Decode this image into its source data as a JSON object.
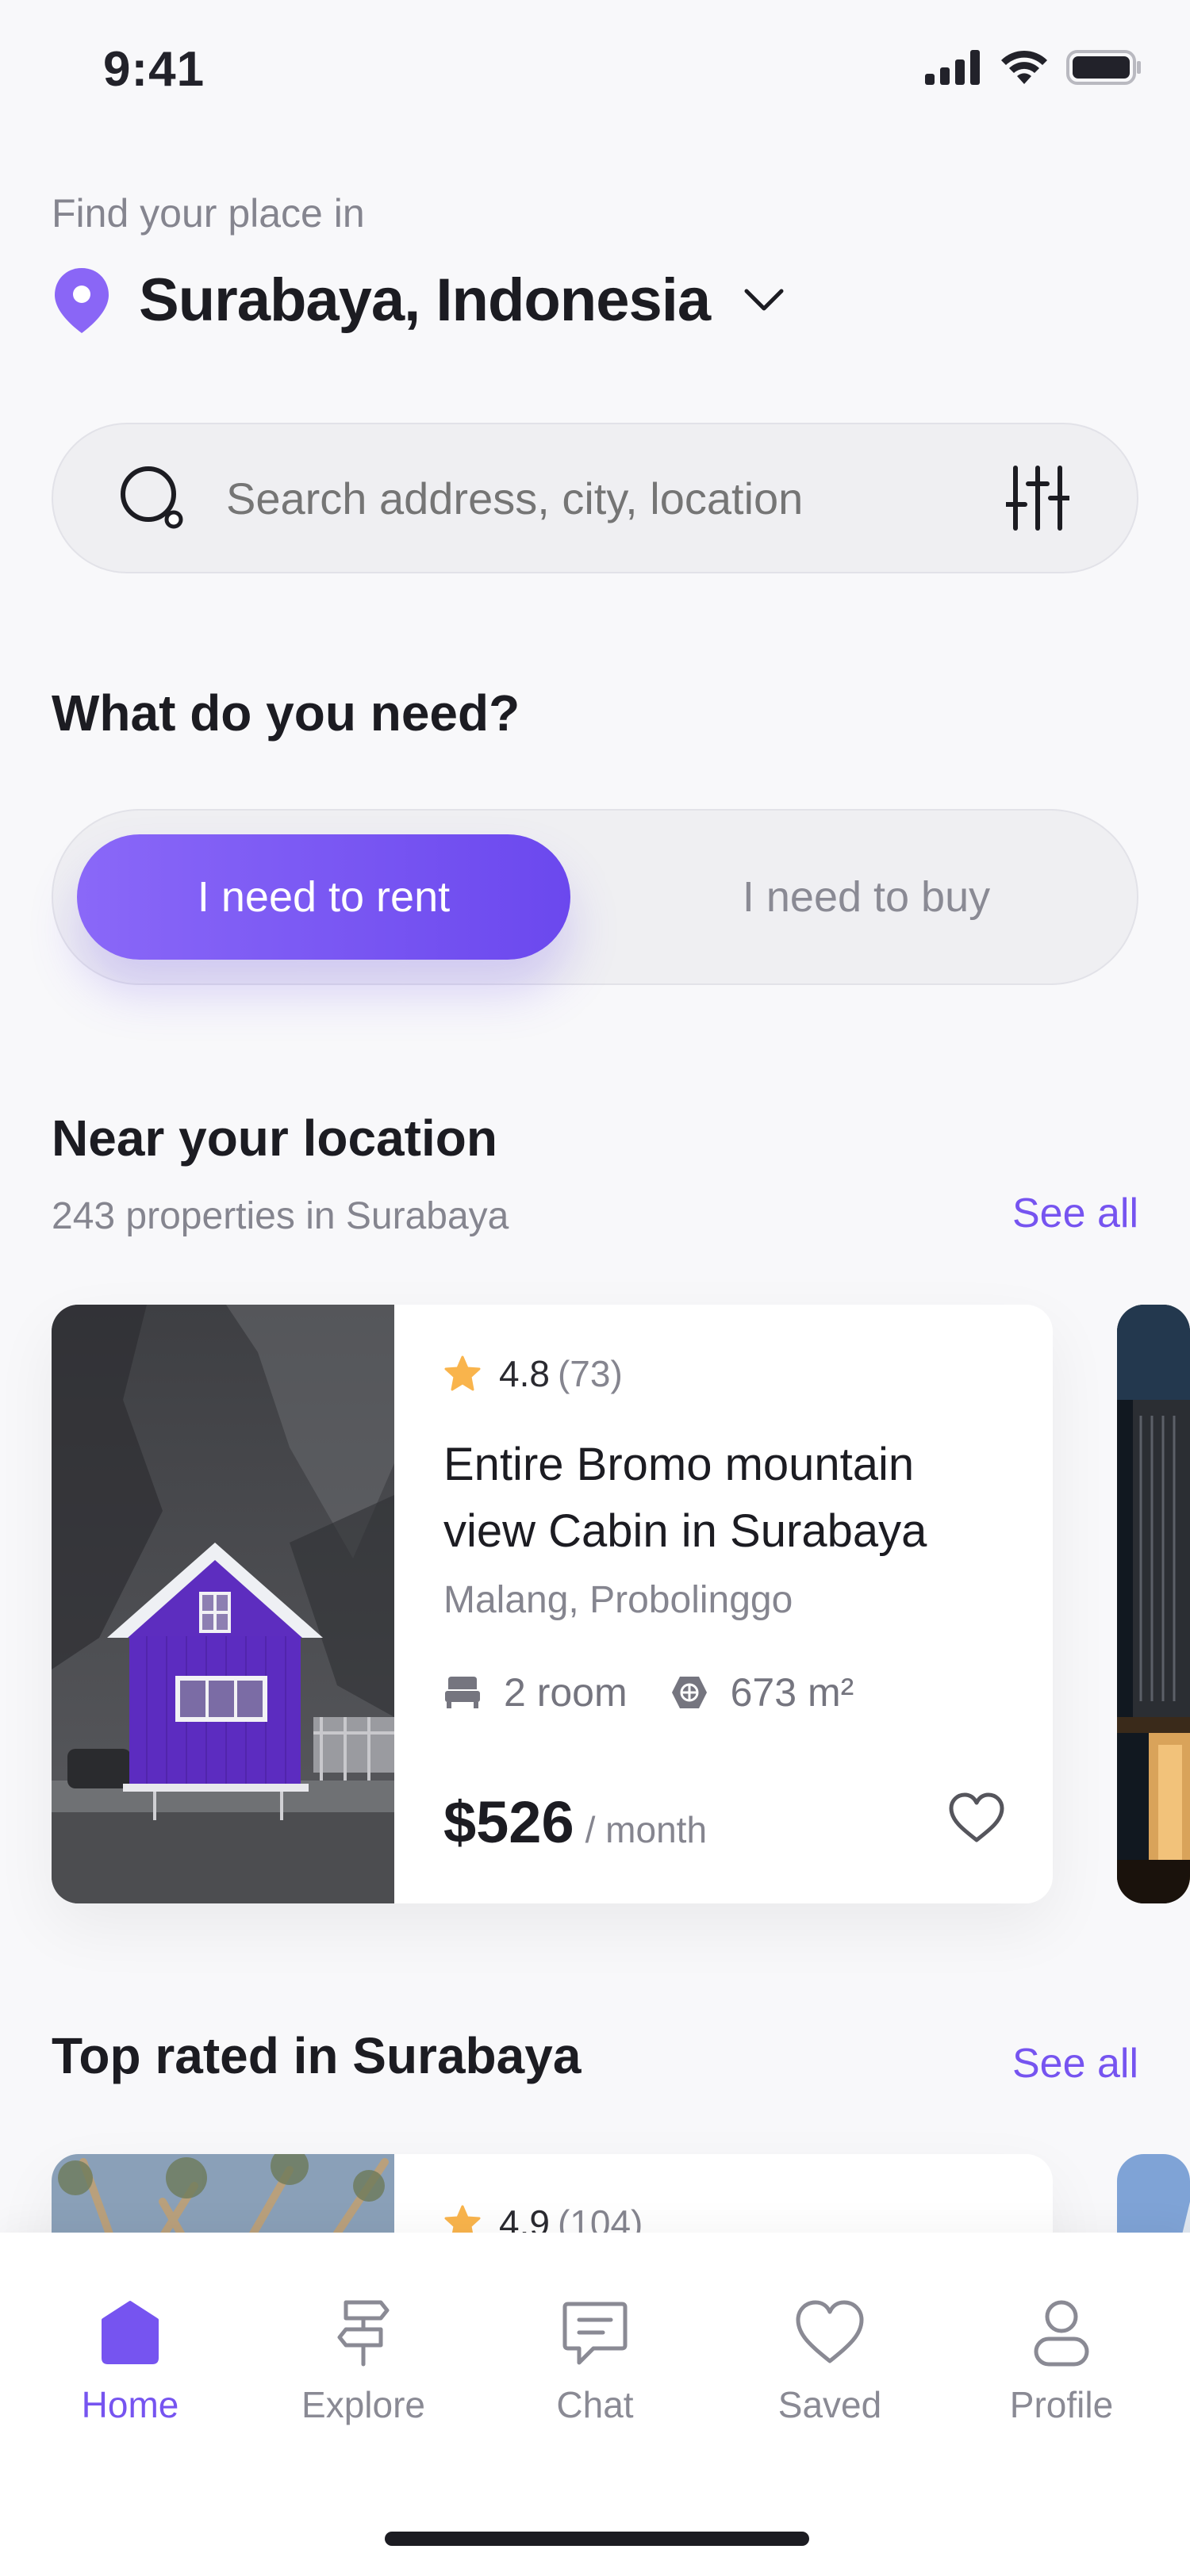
{
  "status_bar": {
    "time": "9:41"
  },
  "header": {
    "find_label": "Find your place in",
    "location": "Surabaya, Indonesia"
  },
  "search": {
    "placeholder": "Search address, city, location"
  },
  "need": {
    "title": "What do you need?",
    "options": [
      {
        "label": "I need to rent",
        "selected": true
      },
      {
        "label": "I need to buy",
        "selected": false
      }
    ]
  },
  "near": {
    "title": "Near your location",
    "subtitle": "243 properties in Surabaya",
    "see_all": "See all",
    "cards": [
      {
        "rating": "4.8",
        "reviews": "(73)",
        "title": "Entire Bromo mountain view Cabin in Surabaya",
        "location": "Malang, Probolinggo",
        "rooms": "2 room",
        "area": "673 m²",
        "price": "$526",
        "period": "/ month"
      }
    ]
  },
  "top_rated": {
    "title": "Top rated in Surabaya",
    "see_all": "See all",
    "cards": [
      {
        "rating": "4.9",
        "reviews": "(104)"
      }
    ]
  },
  "tabs": [
    {
      "label": "Home",
      "icon": "home-icon",
      "active": true
    },
    {
      "label": "Explore",
      "icon": "signpost-icon",
      "active": false
    },
    {
      "label": "Chat",
      "icon": "chat-icon",
      "active": false
    },
    {
      "label": "Saved",
      "icon": "heart-icon",
      "active": false
    },
    {
      "label": "Profile",
      "icon": "profile-icon",
      "active": false
    }
  ],
  "colors": {
    "accent": "#7654f0",
    "star": "#f9b44c",
    "text": "#1c1c22",
    "muted": "#85858f"
  }
}
